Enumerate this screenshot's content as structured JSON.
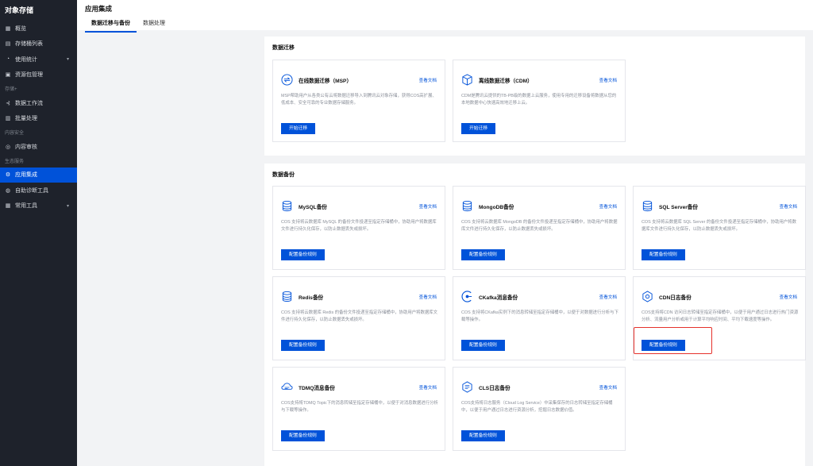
{
  "sidebar": {
    "title": "对象存储",
    "items_top": [
      {
        "label": "概览",
        "icon": "grid-icon"
      },
      {
        "label": "存储桶列表",
        "icon": "bucket-list-icon"
      },
      {
        "label": "使用统计",
        "icon": "pie-chart-icon",
        "has_caret": true
      },
      {
        "label": "资源包管理",
        "icon": "package-icon"
      }
    ],
    "group_storage": "存储+",
    "items_storage": [
      {
        "label": "数据工作流",
        "icon": "workflow-icon"
      },
      {
        "label": "批量处理",
        "icon": "batch-icon"
      }
    ],
    "group_security": "内容安全",
    "items_security": [
      {
        "label": "内容审核",
        "icon": "audit-icon"
      }
    ],
    "group_eco": "生态服务",
    "items_eco": [
      {
        "label": "应用集成",
        "icon": "gear-icon",
        "active": true
      },
      {
        "label": "自助诊断工具",
        "icon": "diagnose-icon"
      },
      {
        "label": "常用工具",
        "icon": "tools-icon",
        "has_caret": true
      }
    ]
  },
  "header": {
    "title": "应用集成",
    "tabs": [
      {
        "label": "数据迁移与备份",
        "active": true
      },
      {
        "label": "数据处理",
        "active": false
      }
    ]
  },
  "migration": {
    "title": "数据迁移",
    "cards": [
      {
        "name": "在线数据迁移（MSP）",
        "doc": "查看文档",
        "desc": "MSP帮助用户从各类公有云将数据迁移导入到腾讯云对象存储，获得COS高扩展、低成本、安全可靠的专业数据存储服务。",
        "button": "开始迁移",
        "icon": "migrate-online-icon"
      },
      {
        "name": "离线数据迁移（CDM）",
        "doc": "查看文档",
        "desc": "CDM是腾讯云提供的TB-PB级的数据上云服务，使用专用的迁移设备将数据从您的本地数据中心快速高效地迁移上云。",
        "button": "开始迁移",
        "icon": "migrate-offline-icon"
      }
    ]
  },
  "backup": {
    "title": "数据备份",
    "cards": [
      {
        "name": "MySQL备份",
        "doc": "查看文档",
        "desc": "COS 支持将云数据库 MySQL 的备份文件投递至指定存储桶中，协助用户将数据库文件进行持久化保存，以防止数据丢失或损坏。",
        "button": "配置备份规则",
        "icon": "database-icon"
      },
      {
        "name": "MongoDB备份",
        "doc": "查看文档",
        "desc": "COS 支持将云数据库 MongoDB 的备份文件投递至指定存储桶中，协助用户将数据库文件进行持久化保存，以防止数据丢失或损坏。",
        "button": "配置备份规则",
        "icon": "database-icon"
      },
      {
        "name": "SQL Server备份",
        "doc": "查看文档",
        "desc": "COS 支持将云数据库 SQL Server 的备份文件投递至指定存储桶中，协助用户将数据库文件进行持久化保存，以防止数据丢失或损坏。",
        "button": "配置备份规则",
        "icon": "database-icon"
      },
      {
        "name": "Redis备份",
        "doc": "查看文档",
        "desc": "COS 支持将云数据库 Redis 的备份文件投递至指定存储桶中，协助用户将数据库文件进行持久化保存，以防止数据丢失或损坏。",
        "button": "配置备份规则",
        "icon": "database-icon"
      },
      {
        "name": "CKafka消息备份",
        "doc": "查看文档",
        "desc": "COS 支持将CKafka实例下的消息转储至指定存储桶中，以便于对数据进行分析与下载等操作。",
        "button": "配置备份规则",
        "icon": "kafka-icon"
      },
      {
        "name": "CDN日志备份",
        "doc": "查看文档",
        "desc": "COS支持将CDN 访问日志转储至指定存储桶中，以便于用户通过日志进行热门资源分析、流量用户分析或用于计算平均响应时间、平均下载速度等操作。",
        "button": "配置备份规则",
        "icon": "cdn-icon"
      },
      {
        "name": "TDMQ消息备份",
        "doc": "查看文档",
        "desc": "COS支持将TDMQ Topic下的消息转储至指定存储桶中，以便于对消息数据进行分析与下载等操作。",
        "button": "配置备份规则",
        "icon": "message-queue-icon"
      },
      {
        "name": "CLS日志备份",
        "doc": "查看文档",
        "desc": "COS支持将日志服务（Cloud Log Service）中采集保存的日志转储至指定存储桶中，以便于用户通过日志进行资源分析，挖掘日志数据价值。",
        "button": "配置备份规则",
        "icon": "log-icon"
      }
    ]
  },
  "colors": {
    "accent": "#0052d9",
    "sidebar_bg": "#1e222b",
    "highlight": "#e5312b"
  }
}
